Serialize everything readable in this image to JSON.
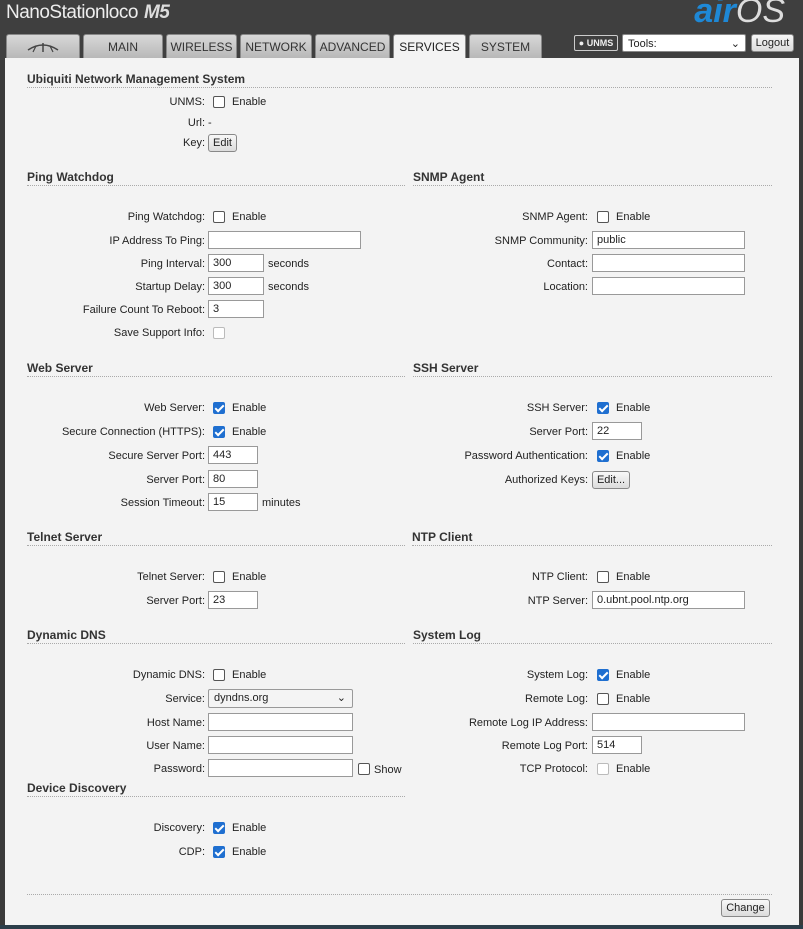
{
  "header": {
    "product": "NanoStation",
    "product_suffix": "loco",
    "model": "M5",
    "logo_air": "air",
    "logo_os": "OS"
  },
  "tabs": [
    {
      "label": "",
      "icon": "ubiquiti-logo-icon"
    },
    {
      "label": "MAIN"
    },
    {
      "label": "WIRELESS"
    },
    {
      "label": "NETWORK"
    },
    {
      "label": "ADVANCED"
    },
    {
      "label": "SERVICES",
      "active": true
    },
    {
      "label": "SYSTEM"
    }
  ],
  "topright": {
    "unms_badge": "UNMS",
    "tools_value": "Tools:",
    "logout": "Logout"
  },
  "unms": {
    "title": "Ubiquiti Network Management System",
    "unms_label": "UNMS:",
    "enable": "Enable",
    "url_label": "Url:",
    "url_value": "-",
    "key_label": "Key:",
    "key_button": "Edit"
  },
  "ping": {
    "title": "Ping Watchdog",
    "ping_label": "Ping Watchdog:",
    "enable": "Enable",
    "ip_label": "IP Address To Ping:",
    "ip_value": "",
    "interval_label": "Ping Interval:",
    "interval_value": "300",
    "interval_unit": "seconds",
    "startup_label": "Startup Delay:",
    "startup_value": "300",
    "startup_unit": "seconds",
    "failure_label": "Failure Count To Reboot:",
    "failure_value": "3",
    "support_label": "Save Support Info:"
  },
  "snmp": {
    "title": "SNMP Agent",
    "agent_label": "SNMP Agent:",
    "enable": "Enable",
    "community_label": "SNMP Community:",
    "community_value": "public",
    "contact_label": "Contact:",
    "contact_value": "",
    "location_label": "Location:",
    "location_value": ""
  },
  "web": {
    "title": "Web Server",
    "server_label": "Web Server:",
    "enable": "Enable",
    "https_label": "Secure Connection (HTTPS):",
    "https_enable": "Enable",
    "secure_port_label": "Secure Server Port:",
    "secure_port_value": "443",
    "port_label": "Server Port:",
    "port_value": "80",
    "timeout_label": "Session Timeout:",
    "timeout_value": "15",
    "timeout_unit": "minutes"
  },
  "ssh": {
    "title": "SSH Server",
    "server_label": "SSH Server:",
    "enable": "Enable",
    "port_label": "Server Port:",
    "port_value": "22",
    "pw_label": "Password Authentication:",
    "pw_enable": "Enable",
    "keys_label": "Authorized Keys:",
    "keys_button": "Edit..."
  },
  "telnet": {
    "title": "Telnet Server",
    "server_label": "Telnet Server:",
    "enable": "Enable",
    "port_label": "Server Port:",
    "port_value": "23"
  },
  "ntp": {
    "title": "NTP Client",
    "client_label": "NTP Client:",
    "enable": "Enable",
    "server_label": "NTP Server:",
    "server_value": "0.ubnt.pool.ntp.org"
  },
  "ddns": {
    "title": "Dynamic DNS",
    "ddns_label": "Dynamic DNS:",
    "enable": "Enable",
    "service_label": "Service:",
    "service_value": "dyndns.org",
    "host_label": "Host Name:",
    "host_value": "",
    "user_label": "User Name:",
    "user_value": "",
    "password_label": "Password:",
    "password_value": "",
    "show_label": "Show"
  },
  "syslog": {
    "title": "System Log",
    "syslog_label": "System Log:",
    "enable": "Enable",
    "remote_label": "Remote Log:",
    "remote_enable": "Enable",
    "remote_ip_label": "Remote Log IP Address:",
    "remote_ip_value": "",
    "remote_port_label": "Remote Log Port:",
    "remote_port_value": "514",
    "tcp_label": "TCP Protocol:",
    "tcp_enable": "Enable"
  },
  "discovery": {
    "title": "Device Discovery",
    "discovery_label": "Discovery:",
    "enable": "Enable",
    "cdp_label": "CDP:",
    "cdp_enable": "Enable"
  },
  "footer": {
    "change_button": "Change"
  }
}
